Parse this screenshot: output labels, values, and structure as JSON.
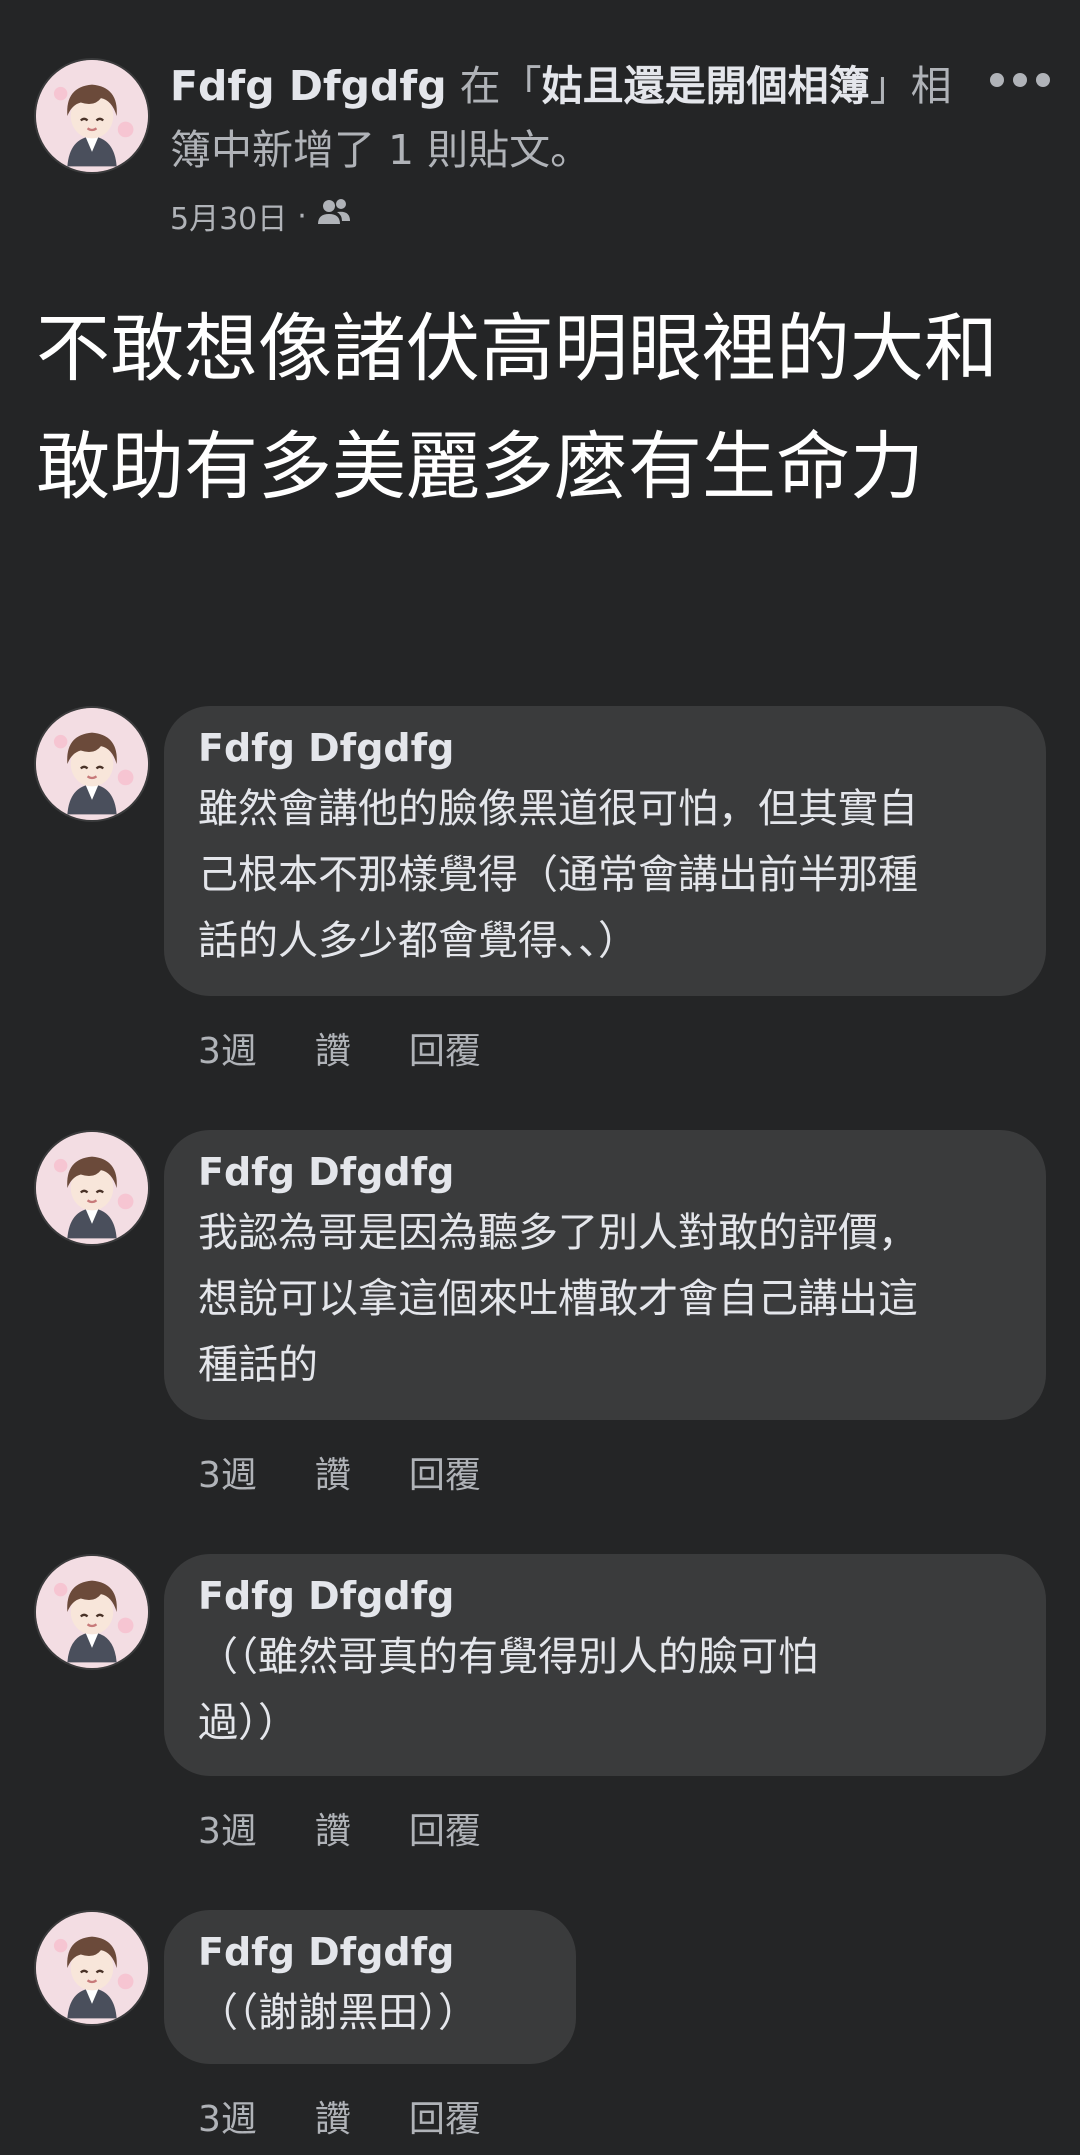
{
  "post": {
    "author": "Fdfg Dfgdfg",
    "action_before": " 在「",
    "album_name": "姑且還是開個相簿",
    "action_after": "」相簿中新增了 1 則貼文。",
    "date": "5月30日",
    "date_separator": "·",
    "privacy_icon": "friends-icon",
    "body": "不敢想像諸伏高明眼裡的大和敢助有多美麗多麼有生命力"
  },
  "comments": [
    {
      "author": "Fdfg Dfgdfg",
      "text": "雖然會講他的臉像黑道很可怕，但其實自\n己根本不那樣覺得（通常會講出前半那種\n話的人多少都會覺得、、）",
      "time": "3週",
      "like": "讚",
      "reply": "回覆"
    },
    {
      "author": "Fdfg Dfgdfg",
      "text": "我認為哥是因為聽多了別人對敢的評價，\n想說可以拿這個來吐槽敢才會自己講出這\n種話的",
      "time": "3週",
      "like": "讚",
      "reply": "回覆"
    },
    {
      "author": "Fdfg Dfgdfg",
      "text": "（（雖然哥真的有覺得別人的臉可怕\n過））",
      "time": "3週",
      "like": "讚",
      "reply": "回覆"
    },
    {
      "author": "Fdfg Dfgdfg",
      "text": "（（謝謝黑田））",
      "time": "3週",
      "like": "讚",
      "reply": "回覆"
    }
  ],
  "colors": {
    "background": "#242526",
    "bubble": "#3a3b3c",
    "primary_text": "#e4e6eb",
    "secondary_text": "#b0b3b8"
  }
}
